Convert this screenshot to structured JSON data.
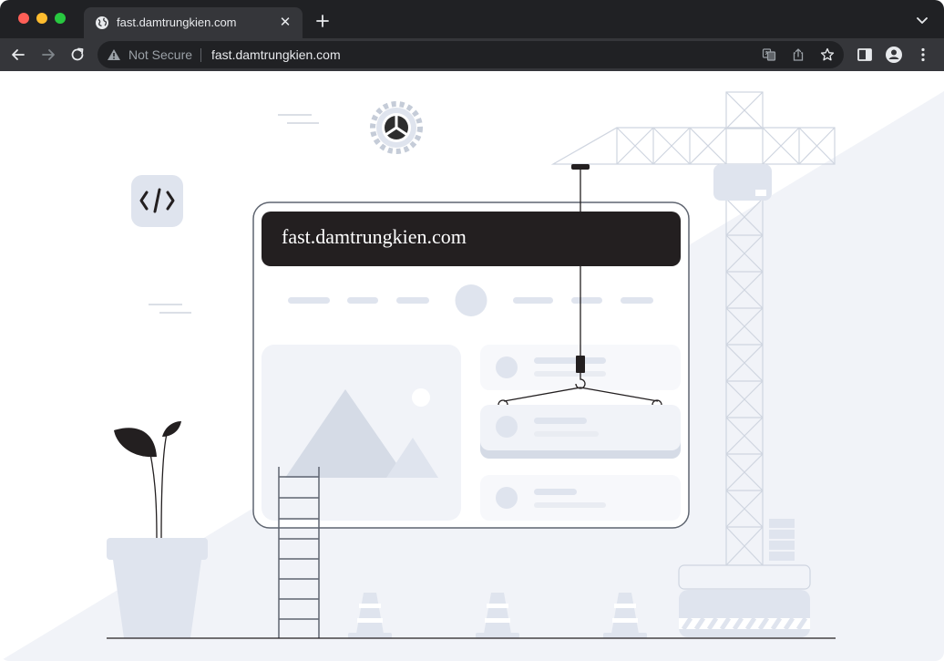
{
  "browser": {
    "tab": {
      "title": "fast.damtrungkien.com",
      "favicon": "globe-icon"
    },
    "toolbar": {
      "security_label": "Not Secure",
      "url": "fast.damtrungkien.com"
    }
  },
  "page": {
    "site_title": "fast.damtrungkien.com"
  },
  "colors": {
    "chrome_dark": "#202124",
    "chrome_toolbar": "#35363a",
    "illustration_light": "#dfe4ee",
    "illustration_bg": "#f1f3f8",
    "ink": "#231f20"
  }
}
